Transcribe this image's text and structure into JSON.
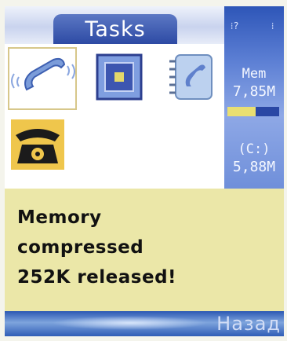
{
  "title_tab": "Tasks",
  "status": {
    "signal_left": "⁞?",
    "signal_right": "⁞",
    "memory_label": "Mem",
    "memory_value": "7,85M",
    "memory_used_fraction": 0.55,
    "drive_label": "(C:)",
    "drive_value": "5,88M"
  },
  "apps": [
    {
      "icon": "phone-handset-icon",
      "selected": true
    },
    {
      "icon": "square-app-icon",
      "selected": false
    },
    {
      "icon": "notebook-handset-icon",
      "selected": false
    },
    {
      "icon": "desk-telephone-icon",
      "selected": false
    }
  ],
  "popup": {
    "lines": [
      "Memory",
      "compressed",
      "252K released!"
    ]
  },
  "softkey_right": "Назад",
  "colors": {
    "tab": "#2d4aa4",
    "popup": "#ebe7a8",
    "status_panel": "#5c7fd4",
    "memory_bar_fill": "#e9df72"
  }
}
